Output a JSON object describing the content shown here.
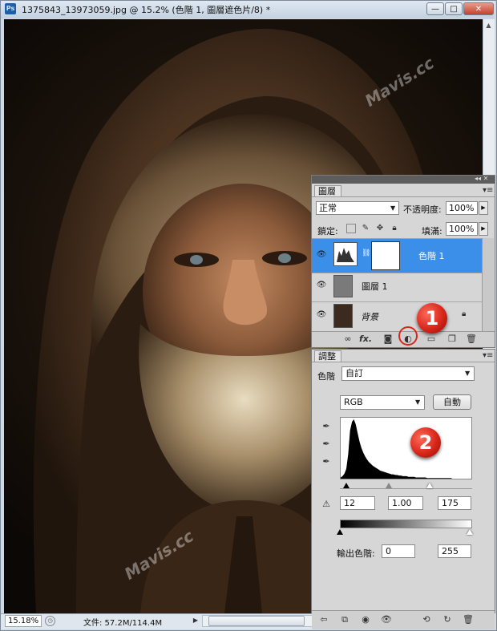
{
  "window": {
    "title": "1375843_13973059.jpg @ 15.2% (色階 1, 圖層遮色片/8) *",
    "app_icon": "Ps",
    "controls": {
      "minimize": "—",
      "maximize": "□",
      "close": "✕"
    }
  },
  "statusbar": {
    "zoom": "15.18%",
    "doc_info": "文件: 57.2M/114.4M"
  },
  "watermark": "Mavis.cc",
  "layers_panel": {
    "tab_label": "圖層",
    "blend_mode": "正常",
    "opacity_label": "不透明度:",
    "opacity_value": "100%",
    "lock_label": "鎖定:",
    "fill_label": "填滿:",
    "fill_value": "100%",
    "layers": [
      {
        "name": "色階 1",
        "visible": true,
        "selected": true
      },
      {
        "name": "圖層 1",
        "visible": true,
        "selected": false
      },
      {
        "name": "背景",
        "visible": true,
        "selected": false,
        "locked": true
      }
    ],
    "footer_icons": [
      "link-icon",
      "fx-icon",
      "mask-icon",
      "adjustment-icon",
      "group-icon",
      "new-layer-icon",
      "trash-icon"
    ],
    "fx_label": "fx."
  },
  "markers": {
    "one": "1",
    "two": "2"
  },
  "adjustments_panel": {
    "tab_label": "調整",
    "levels_label": "色階",
    "preset": "自訂",
    "channel": "RGB",
    "auto_label": "自動",
    "input_black": "12",
    "input_gray": "1.00",
    "input_white": "175",
    "output_label": "輸出色階:",
    "output_black": "0",
    "output_white": "255",
    "histogram": [
      2,
      4,
      8,
      16,
      40,
      78,
      92,
      96,
      88,
      74,
      60,
      50,
      42,
      36,
      31,
      27,
      24,
      21,
      19,
      17,
      15,
      13,
      12,
      11,
      10,
      9,
      8,
      7,
      7,
      6,
      6,
      5,
      5,
      4,
      4,
      4,
      3,
      3,
      3,
      3,
      2,
      2,
      2,
      2,
      2,
      2,
      1,
      1,
      1,
      1,
      1,
      1,
      1,
      1,
      1,
      1,
      1,
      1,
      1,
      1
    ]
  },
  "colors": {
    "selected_layer": "#3c8fe8",
    "marker_red": "#d8261a",
    "panel_gray": "#d6d6d6"
  }
}
